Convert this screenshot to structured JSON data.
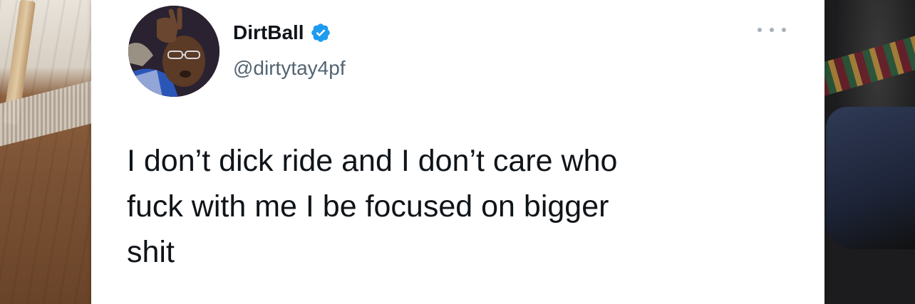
{
  "tweet": {
    "author": {
      "display_name": "DirtBall",
      "handle": "@dirtytay4pf",
      "verified": true,
      "avatar_icon": "profile-photo"
    },
    "text": "I don’t dick ride and I don’t care who\nfuck with me I be focused on bigger\nshit",
    "more_icon": "ellipsis-icon"
  },
  "colors": {
    "verified_badge": "#1d9bf0",
    "text_primary": "#0f1419",
    "text_secondary": "#536471",
    "card_background": "#ffffff"
  }
}
